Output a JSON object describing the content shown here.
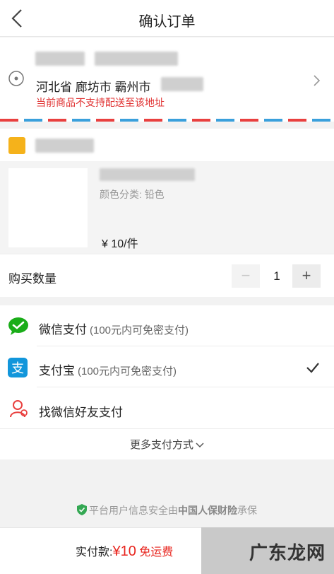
{
  "header": {
    "title": "确认订单"
  },
  "address": {
    "region": "河北省 廊坊市 霸州市",
    "warning": "当前商品不支持配送至该地址"
  },
  "goods": {
    "spec": "颜色分类: 铅色",
    "price": "¥ 10/件"
  },
  "quantity": {
    "label": "购买数量",
    "minus": "−",
    "value": "1",
    "plus": "+"
  },
  "payment": {
    "wechat": {
      "title": "微信支付",
      "note": "(100元内可免密支付)"
    },
    "alipay": {
      "title": "支付宝",
      "note": "(100元内可免密支付)"
    },
    "friend": {
      "title": "找微信好友支付"
    },
    "more": "更多支付方式"
  },
  "security": {
    "prefix": "平台用户信息安全由",
    "brand": "中国人保财险",
    "suffix": "承保"
  },
  "footer": {
    "total_label": "实付款:",
    "amount": "¥10",
    "free_shipping": "免运费"
  },
  "watermark": "广东龙网",
  "colors": {
    "accent": "#e8261f",
    "wechat": "#1aad19",
    "alipay": "#1296db"
  }
}
